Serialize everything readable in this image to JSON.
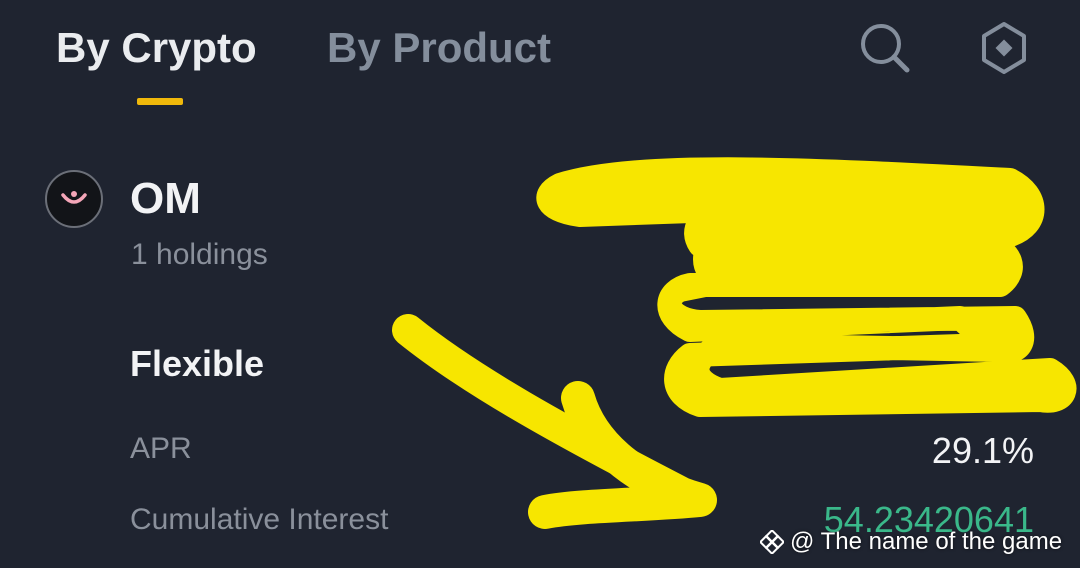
{
  "tabs": {
    "crypto_label": "By Crypto",
    "product_label": "By Product"
  },
  "icons": {
    "search": "search-icon",
    "settings": "settings-icon",
    "coin_logo": "om-coin-logo-icon",
    "watermark": "binance-logo-icon"
  },
  "colors": {
    "background": "#1f2430",
    "accent": "#f0b90b",
    "positive": "#3ab88a",
    "highlight": "#f7e600"
  },
  "coin": {
    "symbol": "OM",
    "holdings": "1 holdings"
  },
  "product": {
    "title": "Flexible",
    "apr_label": "APR",
    "apr_value": "29.1%",
    "interest_label": "Cumulative Interest",
    "interest_value": "54.23420641"
  },
  "watermark": {
    "text": "@ The name of the game"
  }
}
